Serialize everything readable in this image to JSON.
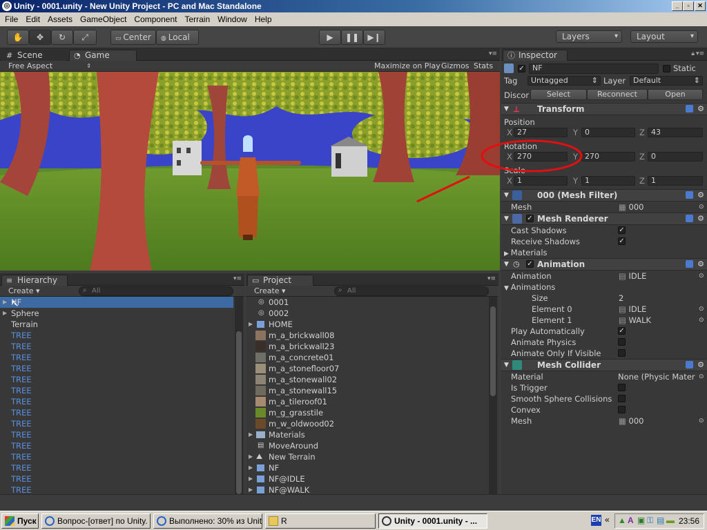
{
  "window": {
    "title": "Unity - 0001.unity - New Unity Project - PC and Mac Standalone"
  },
  "menu": [
    "File",
    "Edit",
    "Assets",
    "GameObject",
    "Component",
    "Terrain",
    "Window",
    "Help"
  ],
  "toolbar": {
    "pivot": "Center",
    "space": "Local",
    "layers": "Layers",
    "layout": "Layout"
  },
  "scene_tabs": {
    "scene": "Scene",
    "game": "Game"
  },
  "game_bar": {
    "aspect": "Free Aspect",
    "maximize": "Maximize on Play",
    "gizmos": "Gizmos",
    "stats": "Stats"
  },
  "hierarchy": {
    "tab": "Hierarchy",
    "create": "Create",
    "search_placeholder": "All",
    "items": [
      "NF",
      "Sphere",
      "Terrain",
      "TREE",
      "TREE",
      "TREE",
      "TREE",
      "TREE",
      "TREE",
      "TREE",
      "TREE",
      "TREE",
      "TREE",
      "TREE",
      "TREE",
      "TREE",
      "TREE",
      "TREE"
    ]
  },
  "project": {
    "tab": "Project",
    "create": "Create",
    "search_placeholder": "All",
    "items": [
      "0001",
      "0002",
      "HOME",
      "m_a_brickwall08",
      "m_a_brickwall23",
      "m_a_concrete01",
      "m_a_stonefloor07",
      "m_a_stonewall02",
      "m_a_stonewall15",
      "m_a_tileroof01",
      "m_g_grasstile",
      "m_w_oldwood02",
      "Materials",
      "MoveAround",
      "New Terrain",
      "NF",
      "NF@IDLE",
      "NF@WALK"
    ],
    "swatch_colors": [
      "#8a7460",
      "#3a2e28",
      "#6f6f68",
      "#9a8f78",
      "#8b8474",
      "#6e6a5e",
      "#a88a70",
      "#6a8a2a",
      "#6b4a2a"
    ]
  },
  "inspector": {
    "tab": "Inspector",
    "name": "NF",
    "static": "Static",
    "tag_label": "Tag",
    "tag": "Untagged",
    "layer_label": "Layer",
    "layer": "Default",
    "prefab_label": "Discor",
    "prefab_select": "Select",
    "prefab_reconnect": "Reconnect",
    "prefab_open": "Open",
    "transform": {
      "title": "Transform",
      "position_label": "Position",
      "position": {
        "x": "27",
        "y": "0",
        "z": "43"
      },
      "rotation_label": "Rotation",
      "rotation": {
        "x": "270",
        "y": "270",
        "z": "0"
      },
      "scale_label": "Scale",
      "scale": {
        "x": "1",
        "y": "1",
        "z": "1"
      }
    },
    "mesh_filter": {
      "title": "000 (Mesh Filter)",
      "mesh_label": "Mesh",
      "mesh": "000"
    },
    "mesh_renderer": {
      "title": "Mesh Renderer",
      "cast": "Cast Shadows",
      "receive": "Receive Shadows",
      "materials": "Materials"
    },
    "animation": {
      "title": "Animation",
      "animation_label": "Animation",
      "animation": "IDLE",
      "animations_label": "Animations",
      "size_label": "Size",
      "size": "2",
      "el0_label": "Element 0",
      "el0": "IDLE",
      "el1_label": "Element 1",
      "el1": "WALK",
      "play_auto": "Play Automatically",
      "physics": "Animate Physics",
      "visible": "Animate Only If Visible"
    },
    "mesh_collider": {
      "title": "Mesh Collider",
      "material_label": "Material",
      "material": "None (Physic Materi",
      "trigger": "Is Trigger",
      "smooth": "Smooth Sphere Collisions",
      "convex": "Convex",
      "mesh_label": "Mesh",
      "mesh": "000"
    }
  },
  "taskbar": {
    "start": "Пуск",
    "tasks": [
      "Вопрос-[ответ] по Unity. ...",
      "Выполнено: 30% из Unit...",
      "R",
      "Unity - 0001.unity - ..."
    ],
    "lang": "EN",
    "clock": "23:56"
  },
  "colors": {
    "accent_selection": "#3d6aa3",
    "annotation": "#e01010",
    "sky": "#3a44c8",
    "grass": "#5d8a28"
  }
}
